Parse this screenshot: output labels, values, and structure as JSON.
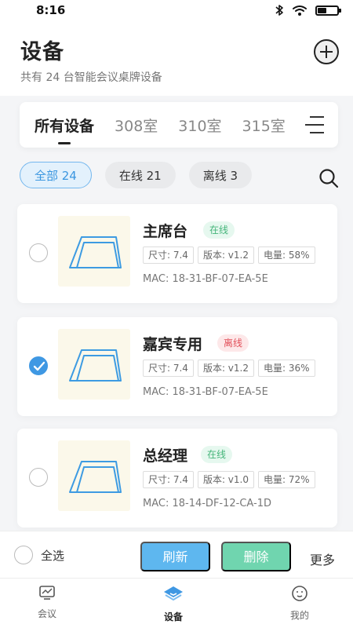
{
  "status_bar": {
    "time": "8:16"
  },
  "header": {
    "title": "设备",
    "subtitle": "共有 24 台智能会议桌牌设备"
  },
  "tabs": [
    {
      "label": "所有设备",
      "active": true
    },
    {
      "label": "308室",
      "active": false
    },
    {
      "label": "310室",
      "active": false
    },
    {
      "label": "315室",
      "active": false
    }
  ],
  "filters": [
    {
      "label": "全部 24",
      "active": true
    },
    {
      "label": "在线 21",
      "active": false
    },
    {
      "label": "离线 3",
      "active": false
    }
  ],
  "devices": [
    {
      "name": "主席台",
      "status": "在线",
      "size": "尺寸: 7.4",
      "version": "版本: v1.2",
      "battery": "电量: 58%",
      "mac": "MAC: 18-31-BF-07-EA-5E",
      "selected": false
    },
    {
      "name": "嘉宾专用",
      "status": "离线",
      "size": "尺寸: 7.4",
      "version": "版本: v1.2",
      "battery": "电量: 36%",
      "mac": "MAC: 18-31-BF-07-EA-5E",
      "selected": true
    },
    {
      "name": "总经理",
      "status": "在线",
      "size": "尺寸: 7.4",
      "version": "版本: v1.0",
      "battery": "电量: 72%",
      "mac": "MAC: 18-14-DF-12-CA-1D",
      "selected": false
    }
  ],
  "actions": {
    "select_all": "全选",
    "refresh": "刷新",
    "delete": "删除",
    "more": "更多"
  },
  "nav": {
    "meeting": "会议",
    "device": "设备",
    "mine": "我的"
  },
  "colors": {
    "accent": "#3f98e3",
    "online": "#45b57a",
    "offline": "#e2505a",
    "delete": "#70d5af"
  },
  "icons": [
    "wifi-icon",
    "bluetooth-icon",
    "battery-icon",
    "plus-circle-icon",
    "menu-icon",
    "search-icon",
    "device-icon",
    "checkmark-icon",
    "meeting-icon",
    "smile-icon"
  ]
}
